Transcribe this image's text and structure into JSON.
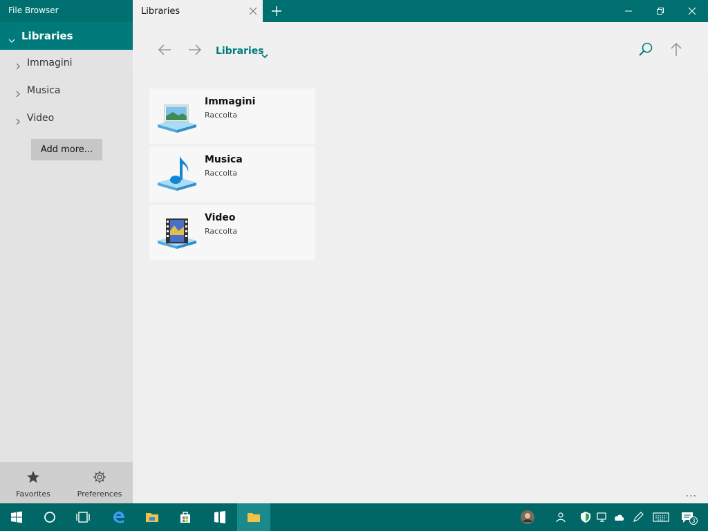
{
  "window": {
    "app_title": "File Browser"
  },
  "tab": {
    "label": "Libraries"
  },
  "sidebar": {
    "root": "Libraries",
    "items": [
      {
        "label": "Immagini"
      },
      {
        "label": "Musica"
      },
      {
        "label": "Video"
      }
    ],
    "add_more": "Add more...",
    "bottom": {
      "favorites": "Favorites",
      "preferences": "Preferences"
    }
  },
  "toolbar": {
    "breadcrumb": "Libraries"
  },
  "libraries": [
    {
      "name": "Immagini",
      "sub": "Raccolta",
      "icon": "pictures-icon"
    },
    {
      "name": "Musica",
      "sub": "Raccolta",
      "icon": "music-icon"
    },
    {
      "name": "Video",
      "sub": "Raccolta",
      "icon": "video-icon"
    }
  ],
  "content": {
    "more": "..."
  },
  "taskbar": {
    "notification_count": "3"
  },
  "colors": {
    "accent": "#006f6f",
    "sidebar_selected": "#007a7a",
    "taskbar": "#006666"
  }
}
